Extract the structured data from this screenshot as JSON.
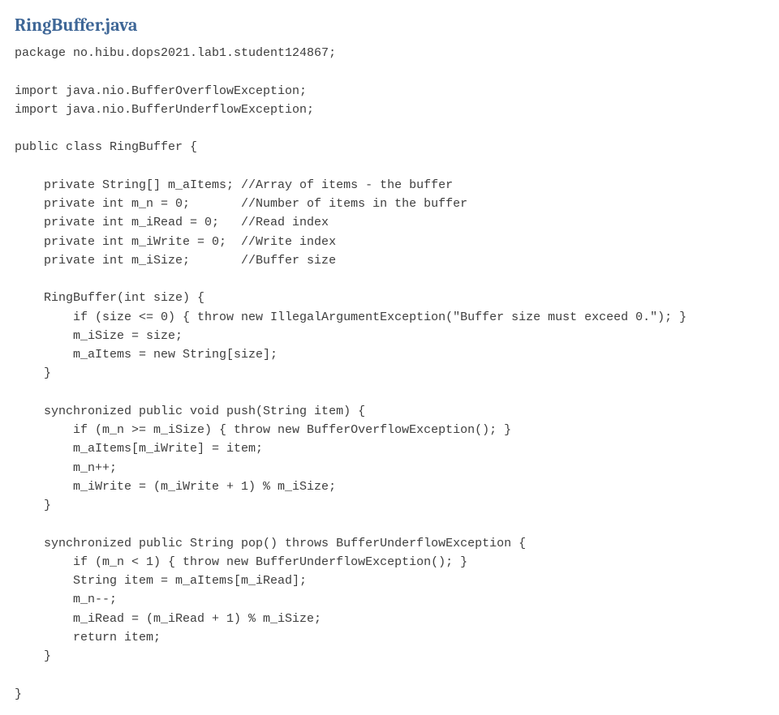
{
  "title": "RingBuffer.java",
  "code": "package no.hibu.dops2021.lab1.student124867;\n\nimport java.nio.BufferOverflowException;\nimport java.nio.BufferUnderflowException;\n\npublic class RingBuffer {\n\n    private String[] m_aItems; //Array of items - the buffer\n    private int m_n = 0;       //Number of items in the buffer\n    private int m_iRead = 0;   //Read index\n    private int m_iWrite = 0;  //Write index\n    private int m_iSize;       //Buffer size\n\n    RingBuffer(int size) {\n        if (size <= 0) { throw new IllegalArgumentException(\"Buffer size must exceed 0.\"); }\n        m_iSize = size;\n        m_aItems = new String[size];\n    }\n\n    synchronized public void push(String item) {\n        if (m_n >= m_iSize) { throw new BufferOverflowException(); }\n        m_aItems[m_iWrite] = item;\n        m_n++;\n        m_iWrite = (m_iWrite + 1) % m_iSize;\n    }\n\n    synchronized public String pop() throws BufferUnderflowException {\n        if (m_n < 1) { throw new BufferUnderflowException(); }\n        String item = m_aItems[m_iRead];\n        m_n--;\n        m_iRead = (m_iRead + 1) % m_iSize;\n        return item;\n    }\n\n}"
}
